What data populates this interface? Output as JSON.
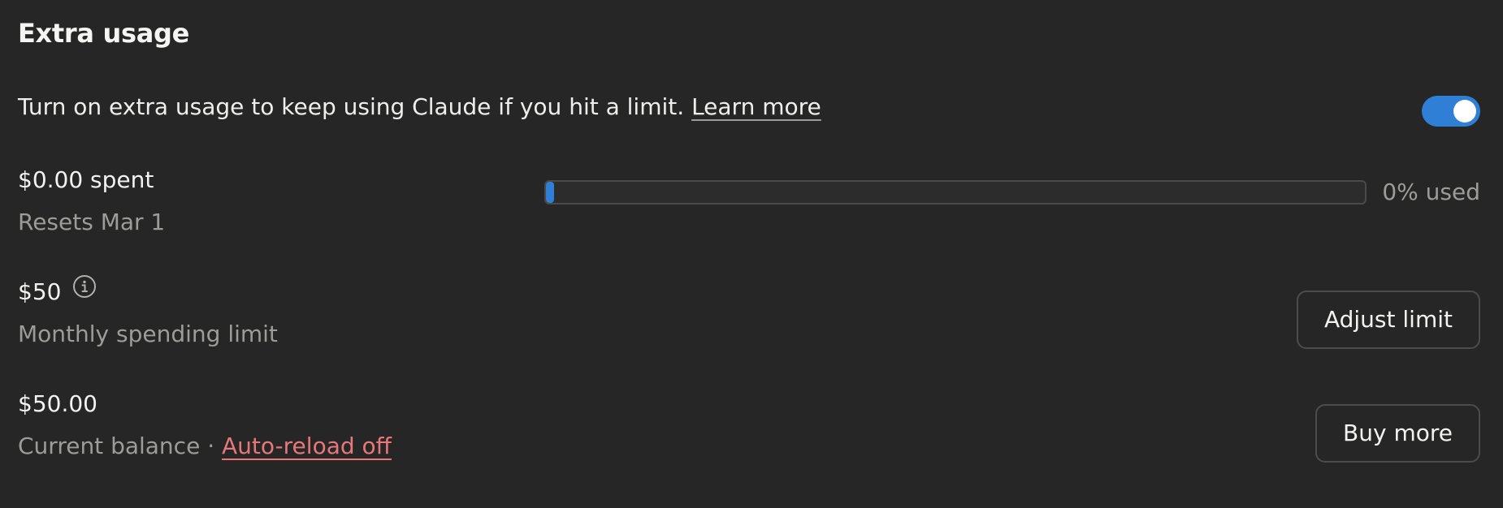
{
  "section": {
    "title": "Extra usage"
  },
  "description": {
    "text": "Turn on extra usage to keep using Claude if you hit a limit.",
    "link_label": "Learn more",
    "toggle_on": true
  },
  "spent": {
    "amount": "$0.00 spent",
    "resets": "Resets Mar 1",
    "used_fraction": 0,
    "used_label": "0% used"
  },
  "limit": {
    "amount": "$50",
    "label": "Monthly spending limit",
    "button_label": "Adjust limit"
  },
  "balance": {
    "amount": "$50.00",
    "label": "Current balance",
    "separator": "·",
    "auto_reload_label": "Auto-reload off",
    "button_label": "Buy more"
  },
  "colors": {
    "accent": "#2f7fd6",
    "warning_link": "#e8777a",
    "background": "#262626"
  }
}
